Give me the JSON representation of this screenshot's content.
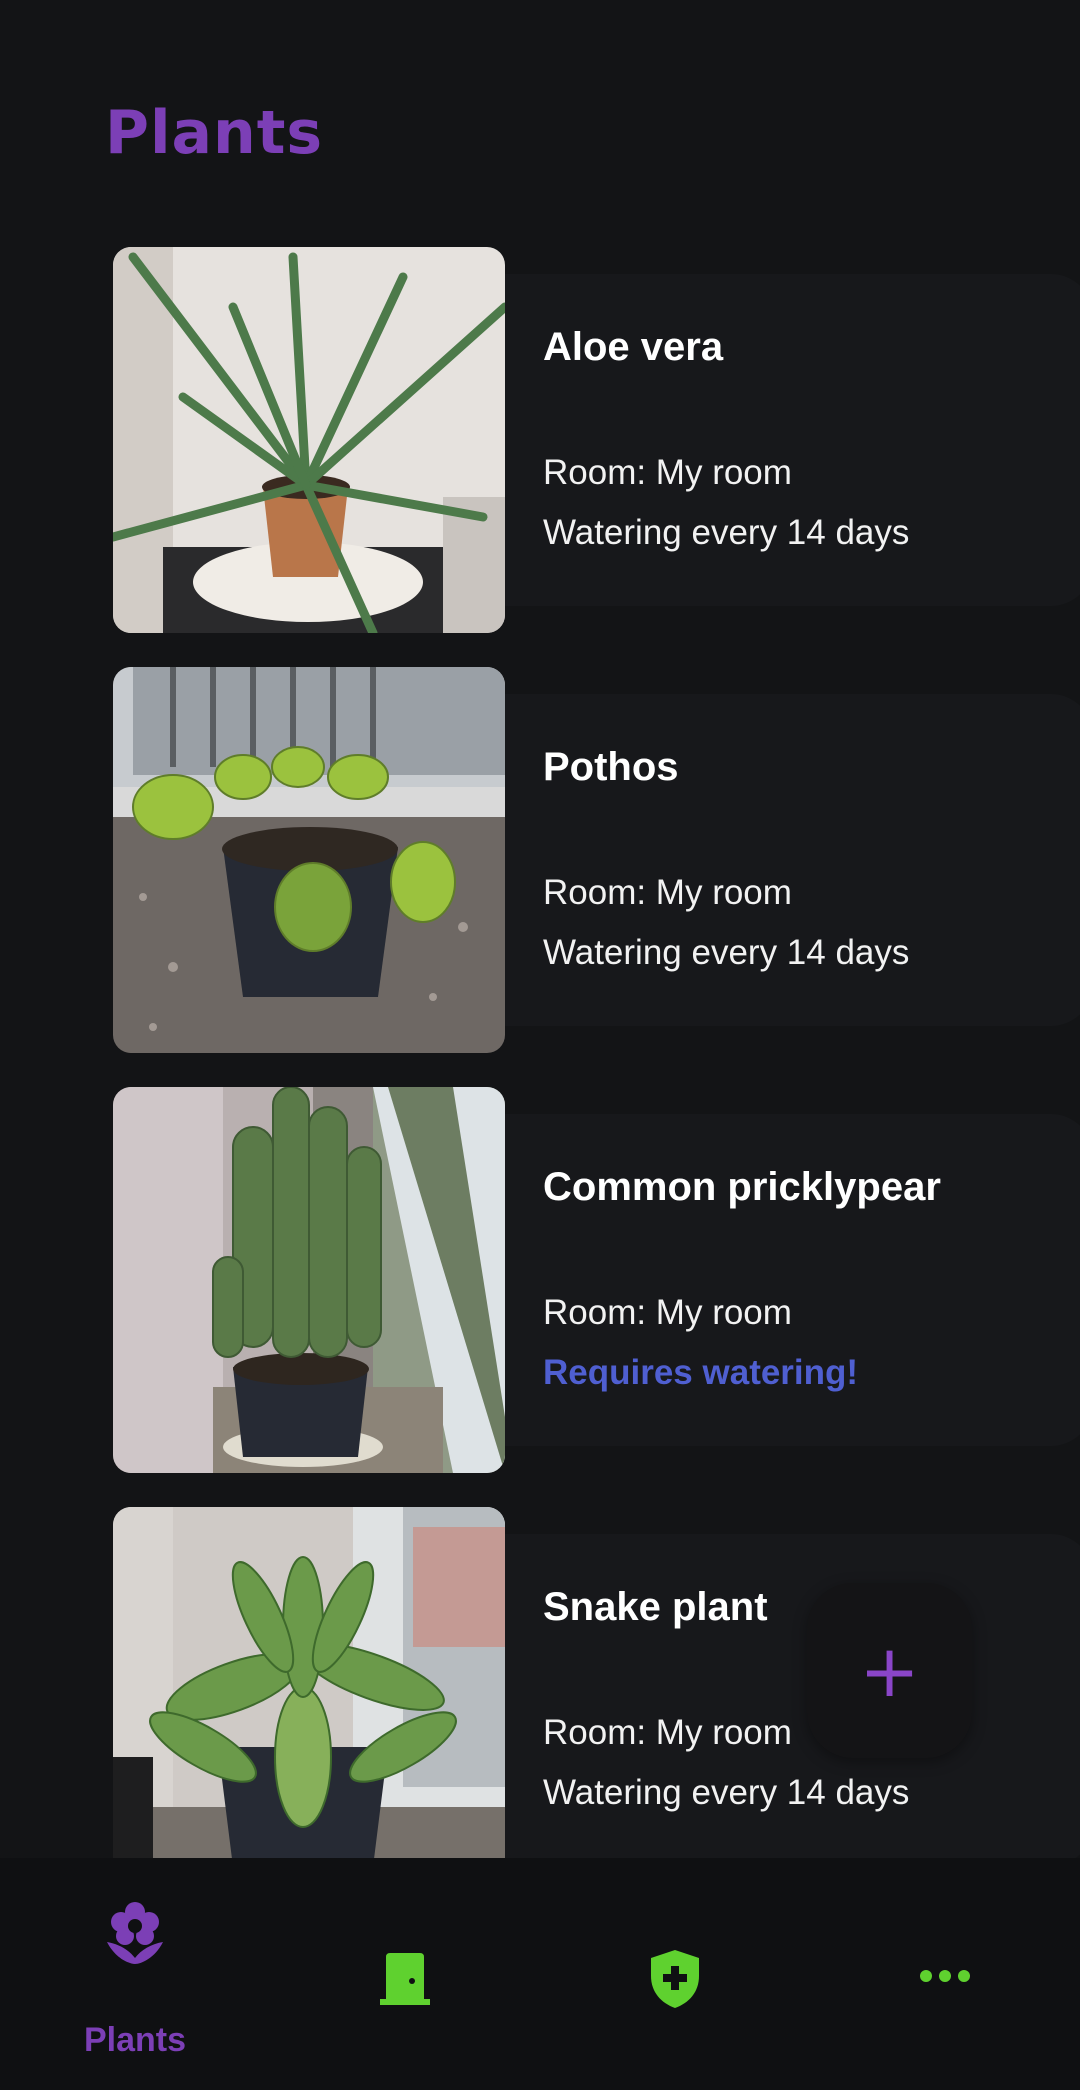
{
  "header": {
    "title": "Plants"
  },
  "colors": {
    "accent": "#7c3fb6",
    "nav_icon_inactive": "#5fd12f",
    "watering_alert": "#4f5fd1",
    "background": "#131416",
    "card": "#17181b"
  },
  "plants": [
    {
      "name": "Aloe vera",
      "room": "Room: My room",
      "watering": "Watering every 14 days",
      "needs_water": false,
      "image": "aloe-vera-photo"
    },
    {
      "name": "Pothos",
      "room": "Room: My room",
      "watering": "Watering every 14 days",
      "needs_water": false,
      "image": "pothos-photo"
    },
    {
      "name": "Common pricklypear",
      "room": "Room: My room",
      "watering": "Requires watering!",
      "needs_water": true,
      "image": "cactus-photo"
    },
    {
      "name": "Snake plant",
      "room": "Room: My room",
      "watering": "Watering every 14 days",
      "needs_water": false,
      "image": "snake-plant-photo"
    }
  ],
  "fab": {
    "icon": "plus-icon",
    "symbol": "+"
  },
  "bottom_nav": {
    "items": [
      {
        "label": "Plants",
        "icon": "flower-icon",
        "active": true
      },
      {
        "label": "",
        "icon": "door-icon",
        "active": false
      },
      {
        "label": "",
        "icon": "shield-plus-icon",
        "active": false
      },
      {
        "label": "",
        "icon": "more-dots-icon",
        "active": false
      }
    ]
  }
}
